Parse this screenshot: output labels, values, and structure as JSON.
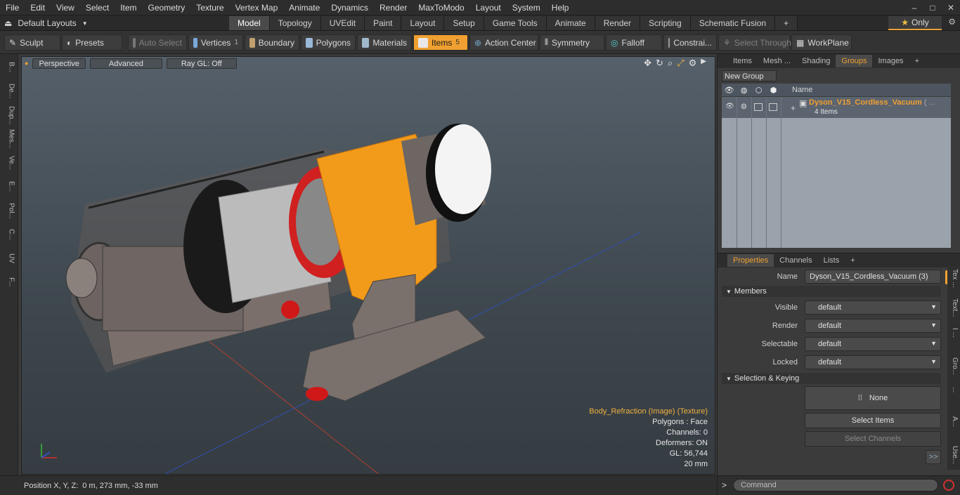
{
  "menu": [
    "File",
    "Edit",
    "View",
    "Select",
    "Item",
    "Geometry",
    "Texture",
    "Vertex Map",
    "Animate",
    "Dynamics",
    "Render",
    "MaxToModo",
    "Layout",
    "System",
    "Help"
  ],
  "layouts": {
    "label": "Default Layouts"
  },
  "main_tabs": [
    {
      "label": "Model",
      "active": true
    },
    {
      "label": "Topology"
    },
    {
      "label": "UVEdit"
    },
    {
      "label": "Paint"
    },
    {
      "label": "Layout"
    },
    {
      "label": "Setup"
    },
    {
      "label": "Game Tools"
    },
    {
      "label": "Animate"
    },
    {
      "label": "Render"
    },
    {
      "label": "Scripting"
    },
    {
      "label": "Schematic Fusion"
    }
  ],
  "only_label": "Only",
  "toolbar": {
    "sculpt": "Sculpt",
    "presets": "Presets",
    "auto_select": "Auto Select",
    "vertices": "Vertices",
    "vertices_count": "1",
    "boundary": "Boundary",
    "polygons": "Polygons",
    "materials": "Materials",
    "items": "Items",
    "items_count": "5",
    "action_center": "Action Center",
    "symmetry": "Symmetry",
    "falloff": "Falloff",
    "constraints": "Constrai...",
    "select_through": "Select Through",
    "workplane": "WorkPlane"
  },
  "left_strip": [
    "B...",
    "De...",
    "Dup...",
    "Mes...",
    "Ve...",
    "E...",
    "Pol...",
    "C...",
    "UV",
    "F..."
  ],
  "viewport": {
    "view_mode": "Perspective",
    "shading": "Advanced",
    "raygl": "Ray GL: Off",
    "info": {
      "texture": "Body_Refraction (Image) (Texture)",
      "polygons": "Polygons : Face",
      "channels": "Channels: 0",
      "deformers": "Deformers: ON",
      "gl": "GL: 56,744",
      "scale": "20 mm"
    }
  },
  "status": {
    "label": "Position X, Y, Z:",
    "value": "0 m, 273 mm, -33 mm"
  },
  "right_top": {
    "tabs": [
      {
        "label": "Items"
      },
      {
        "label": "Mesh ..."
      },
      {
        "label": "Shading"
      },
      {
        "label": "Groups",
        "active": true
      },
      {
        "label": "Images"
      }
    ],
    "new_group": "New Group",
    "col_name": "Name",
    "group_name": "Dyson_V15_Cordless_Vacuum",
    "group_suffix": "( ...",
    "group_items": "4 Items"
  },
  "right_bottom": {
    "tabs": [
      {
        "label": "Properties",
        "active": true
      },
      {
        "label": "Channels"
      },
      {
        "label": "Lists"
      }
    ],
    "name_label": "Name",
    "name_value": "Dyson_V15_Cordless_Vacuum (3)",
    "members": "Members",
    "visible_label": "Visible",
    "visible_value": "default",
    "render_label": "Render",
    "render_value": "default",
    "selectable_label": "Selectable",
    "selectable_value": "default",
    "locked_label": "Locked",
    "locked_value": "default",
    "sel_keying": "Selection & Keying",
    "none_label": "None",
    "select_items": "Select Items",
    "select_channels": "Select Channels",
    "more": ">>",
    "side_tabs": [
      "Tex ...",
      "Text...",
      "I ...",
      "Gro...",
      "...",
      "A...",
      "Use..."
    ]
  },
  "command": {
    "placeholder": "Command"
  }
}
